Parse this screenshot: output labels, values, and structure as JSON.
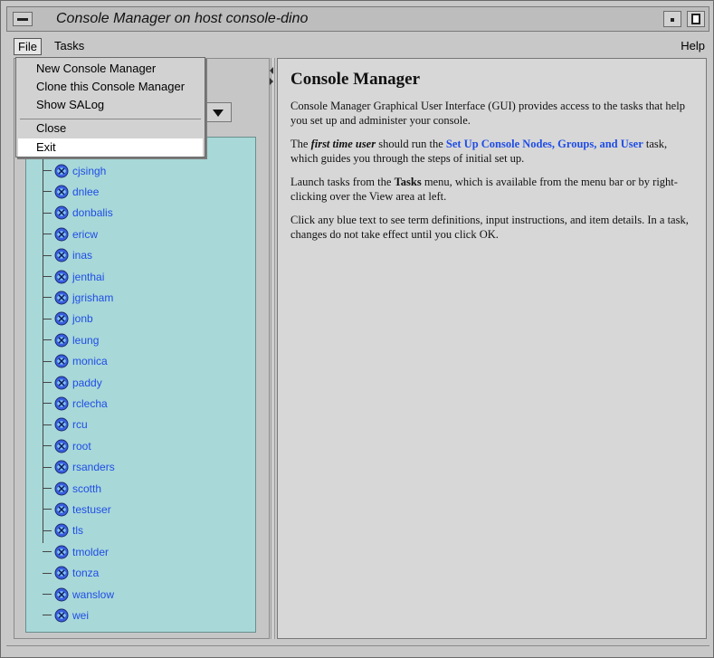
{
  "window": {
    "title": "Console Manager on host console-dino"
  },
  "menubar": {
    "file": "File",
    "tasks": "Tasks",
    "help": "Help"
  },
  "file_menu": {
    "items": [
      "New Console Manager",
      "Clone this Console Manager",
      "Show SALog",
      "Close",
      "Exit"
    ],
    "highlighted": "Exit"
  },
  "tree": {
    "items": [
      "cjsingh",
      "dnlee",
      "donbalis",
      "ericw",
      "inas",
      "jenthai",
      "jgrisham",
      "jonb",
      "leung",
      "monica",
      "paddy",
      "rclecha",
      "rcu",
      "root",
      "rsanders",
      "scotth",
      "testuser",
      "tls",
      "tmolder",
      "tonza",
      "wanslow",
      "wei"
    ],
    "link_color": "#1f4de6",
    "background_color": "#a8d8d8"
  },
  "content": {
    "heading": "Console Manager",
    "p1": "Console Manager Graphical User Interface (GUI) provides access to the tasks that help you set up and administer your console.",
    "p2_prefix": "The ",
    "p2_em": "first time user",
    "p2_mid": " should run the ",
    "p2_link": "Set Up Console Nodes, Groups, and User",
    "p2_suffix": " task, which guides you through the steps of initial set up.",
    "p3_prefix": "Launch tasks from the ",
    "p3_strong": "Tasks",
    "p3_suffix": " menu, which is available from the menu bar or by right-clicking over the View area at left.",
    "p4": "Click any blue text to see term definitions, input instructions, and item details. In a task, changes do not take effect until you click OK."
  }
}
